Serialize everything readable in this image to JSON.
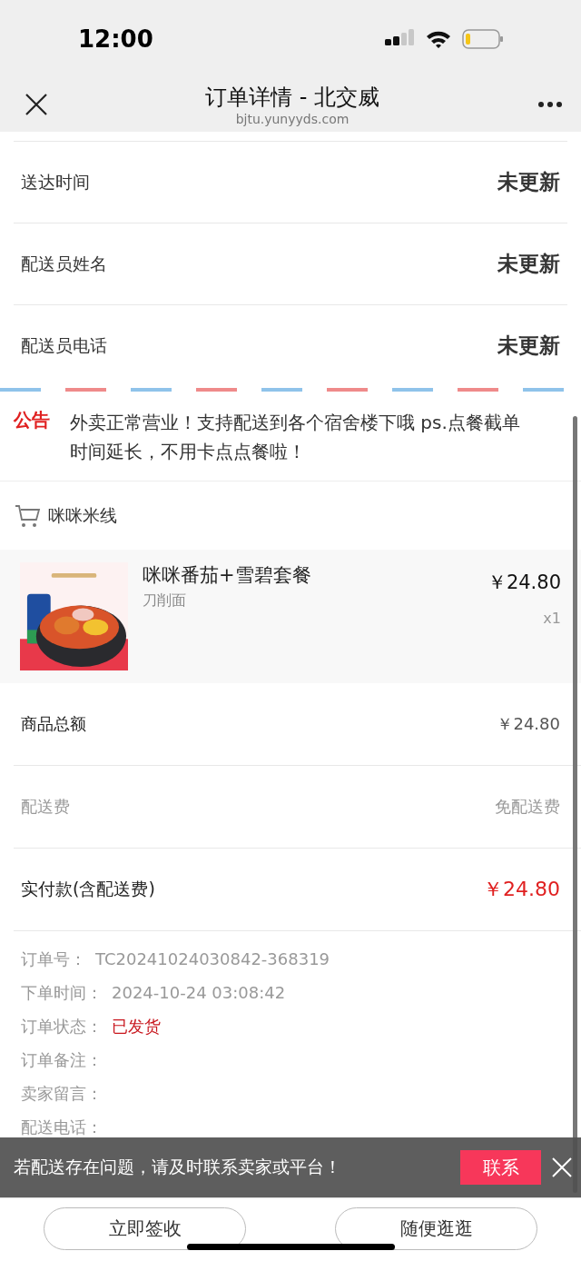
{
  "status_bar": {
    "time": "12:00"
  },
  "header": {
    "title": "订单详情 - 北交威",
    "url": "bjtu.yunyyds.com"
  },
  "delivery_rows": [
    {
      "label": "送达时间",
      "value": "未更新"
    },
    {
      "label": "配送员姓名",
      "value": "未更新"
    },
    {
      "label": "配送员电话",
      "value": "未更新"
    }
  ],
  "notice": {
    "tag": "公告",
    "text": "外卖正常营业！支持配送到各个宿舍楼下哦 ps.点餐截单时间延长，不用卡点点餐啦！"
  },
  "shop": {
    "name": "咪咪米线"
  },
  "items": [
    {
      "name": "咪咪番茄+雪碧套餐",
      "spec": "刀削面",
      "price": "￥24.80",
      "quantity": "x1"
    }
  ],
  "summary": [
    {
      "label": "商品总额",
      "value": "￥24.80",
      "kind": "normal"
    },
    {
      "label": "配送费",
      "value": "免配送费",
      "kind": "muted"
    },
    {
      "label": "实付款(含配送费)",
      "value": "￥24.80",
      "kind": "total"
    }
  ],
  "order_info": [
    {
      "label": "订单号：",
      "value": "TC20241024030842-368319",
      "kind": "plain"
    },
    {
      "label": "下单时间：",
      "value": "2024-10-24 03:08:42",
      "kind": "plain"
    },
    {
      "label": "订单状态：",
      "value": "已发货",
      "kind": "status"
    },
    {
      "label": "订单备注："
    },
    {
      "label": "卖家留言："
    },
    {
      "label": "配送电话："
    }
  ],
  "banner": {
    "text": "若配送存在问题，请及时联系卖家或平台！",
    "button": "联系"
  },
  "actions": [
    "立即签收",
    "随便逛逛"
  ]
}
